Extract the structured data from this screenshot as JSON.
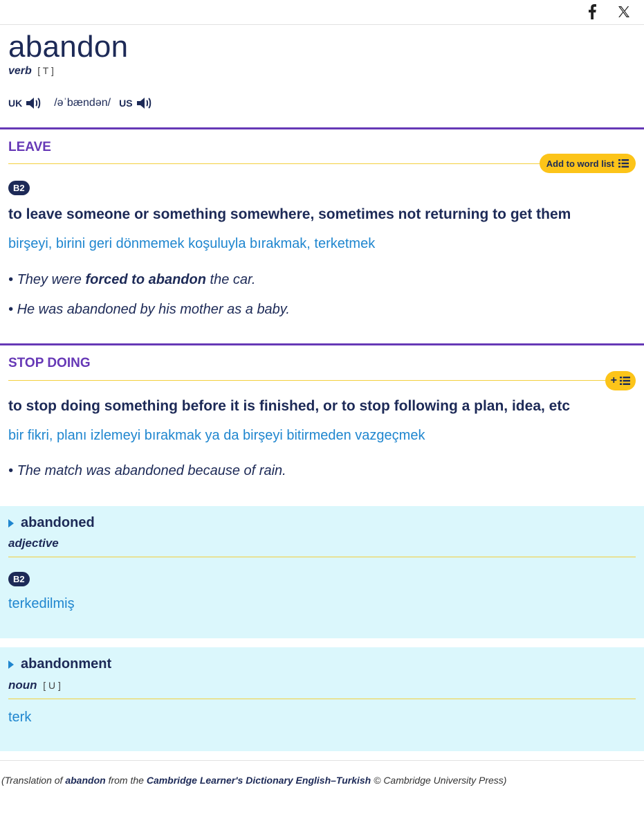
{
  "share": {
    "facebook_icon": "facebook-icon",
    "x_icon": "x-twitter-icon"
  },
  "entry": {
    "headword": "abandon",
    "pos": "verb",
    "grammar": "[ T ]",
    "pron": {
      "uk_label": "UK",
      "ipa": "/əˈbændən/",
      "us_label": "US"
    }
  },
  "senses": [
    {
      "title": "LEAVE",
      "word_list_label": "Add to word list",
      "level": "B2",
      "definition": "to leave someone or something somewhere, sometimes not returning to get them",
      "translation": "birşeyi, birini geri dönmemek koşuluyla bırakmak, terketmek",
      "examples": [
        {
          "before": "They were ",
          "bold": "forced to abandon",
          "after": " the car."
        },
        {
          "before": "He was abandoned by his mother as a baby.",
          "bold": "",
          "after": ""
        }
      ]
    },
    {
      "title": "STOP DOING",
      "word_list_label": "+",
      "definition": "to stop doing something before it is finished, or to stop following a plan, idea, etc",
      "translation": "bir fikri, planı izlemeyi bırakmak ya da birşeyi bitirmeden vazgeçmek",
      "examples": [
        {
          "before": "The match was abandoned because of rain.",
          "bold": "",
          "after": ""
        }
      ]
    }
  ],
  "run_ons": [
    {
      "word": "abandoned",
      "pos": "adjective",
      "grammar": "",
      "level": "B2",
      "translation": "terkedilmiş"
    },
    {
      "word": "abandonment",
      "pos": "noun",
      "grammar": "[ U ]",
      "translation": "terk"
    }
  ],
  "footer": {
    "p1": "(Translation of ",
    "word": "abandon",
    "p2": " from the ",
    "dict": "Cambridge Learner's Dictionary English–Turkish",
    "p3": " © Cambridge University Press)"
  }
}
